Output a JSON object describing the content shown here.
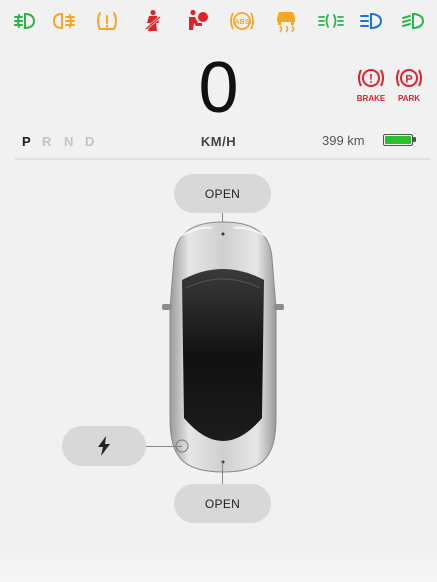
{
  "telltales": [
    {
      "name": "fog-light-front-icon",
      "color": "#2bb34a"
    },
    {
      "name": "fog-light-rear-icon",
      "color": "#f5a623"
    },
    {
      "name": "tire-pressure-warning-icon",
      "color": "#f5a623"
    },
    {
      "name": "seatbelt-warning-icon",
      "color": "#e0222a"
    },
    {
      "name": "airbag-warning-icon",
      "color": "#e0222a"
    },
    {
      "name": "abs-warning-icon",
      "color": "#f5a623"
    },
    {
      "name": "traction-control-icon",
      "color": "#f5a623"
    },
    {
      "name": "parking-lights-icon",
      "color": "#2bb34a"
    },
    {
      "name": "high-beam-icon",
      "color": "#1f6fe5"
    },
    {
      "name": "low-beam-icon",
      "color": "#2bb34a"
    }
  ],
  "speed": {
    "value": "0",
    "unit": "KM/H"
  },
  "gears": [
    "P",
    "R",
    "N",
    "D"
  ],
  "active_gear": "P",
  "range": {
    "text": "399 km",
    "battery_level": 1.0,
    "battery_color": "#2ac12c"
  },
  "warnings": {
    "brake": {
      "label": "BRAKE",
      "icon": "brake-warning-icon",
      "glyph": "!"
    },
    "park": {
      "label": "PARK",
      "icon": "parking-brake-icon",
      "glyph": "P"
    }
  },
  "controls": {
    "frunk_label": "OPEN",
    "trunk_label": "OPEN",
    "charge_port_icon": "lightning-bolt-icon"
  }
}
